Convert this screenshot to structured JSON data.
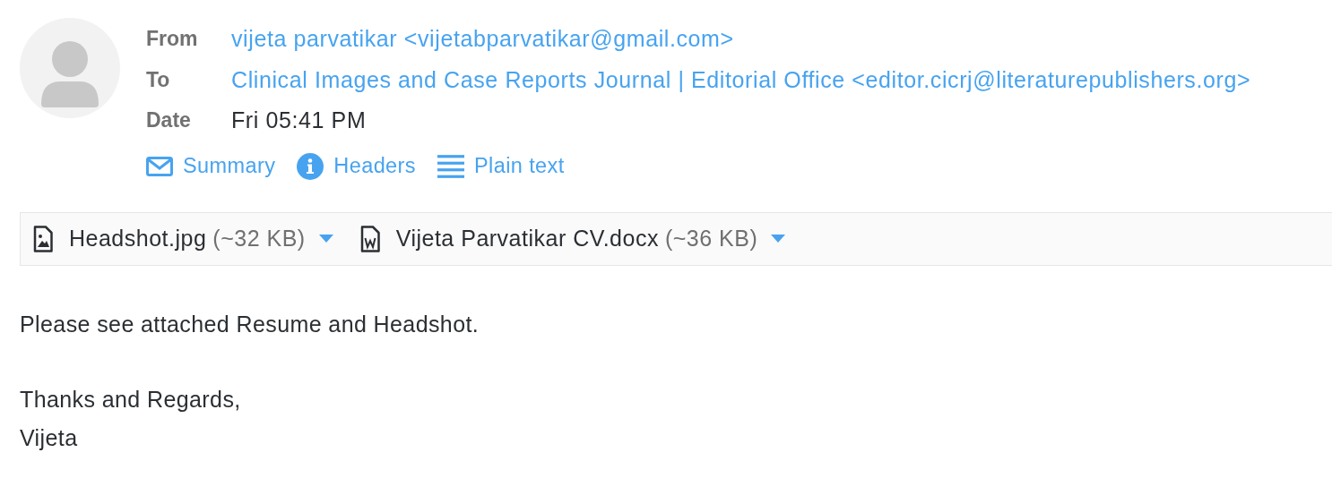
{
  "headers": [
    {
      "label": "From",
      "value": "vijeta parvatikar <vijetabparvatikar@gmail.com>",
      "kind": "link"
    },
    {
      "label": "To",
      "value": "Clinical Images and Case Reports Journal | Editorial Office <editor.cicrj@literaturepublishers.org>",
      "kind": "link"
    },
    {
      "label": "Date",
      "value": "Fri 05:41 PM",
      "kind": "text"
    }
  ],
  "view_modes": [
    {
      "label": "Summary",
      "kind": "envelope"
    },
    {
      "label": "Headers",
      "kind": "info"
    },
    {
      "label": "Plain text",
      "kind": "lines"
    }
  ],
  "attachments": [
    {
      "name": "Headshot.jpg",
      "size": "(~32 KB)",
      "kind": "image"
    },
    {
      "name": "Vijeta Parvatikar CV.docx",
      "size": "(~36 KB)",
      "kind": "word"
    }
  ],
  "body": [
    [
      "Please see attached Resume and Headshot."
    ],
    [
      "Thanks and Regards,",
      "Vijeta"
    ]
  ]
}
